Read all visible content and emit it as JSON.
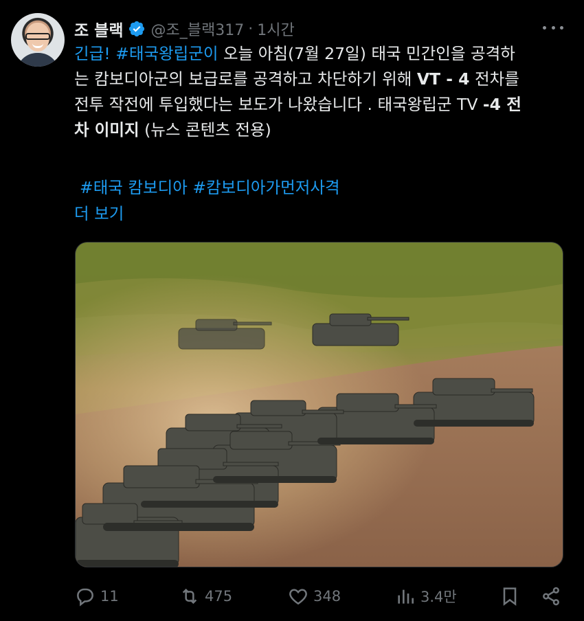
{
  "author": {
    "display_name": "조 블랙",
    "handle": "@조_블랙317",
    "separator": "·",
    "time": "1시간"
  },
  "tweet": {
    "segments": [
      {
        "text": "긴급! #태국왕립군이",
        "style": "link"
      },
      {
        "text": " 오늘 아침(7월 27일) 태국 민간인을 공격하",
        "style": "normal"
      },
      {
        "text": "는 캄보디아군의 보급로를 공격하고 차단하기 위해 ",
        "style": "normal"
      },
      {
        "text": "VT - 4",
        "style": "bold"
      },
      {
        "text": " 전차를",
        "style": "normal"
      },
      {
        "text": "전투 작전에 투입했다는 보도가 나왔습니다 . 태국왕립군 TV ",
        "style": "normal"
      },
      {
        "text": "-4 전",
        "style": "bold"
      },
      {
        "text": "차 이미지",
        "style": "bold"
      },
      {
        "text": " (뉴스 콘텐츠 전용)",
        "style": "normal"
      }
    ],
    "hashtags": "#태국 캄보디아 #캄보디아가먼저사격",
    "show_more": "더 보기"
  },
  "actions": {
    "reply_count": "11",
    "retweet_count": "475",
    "like_count": "348",
    "view_count": "3.4만"
  },
  "icons": [
    "verified-badge-icon",
    "more-options-icon",
    "reply-icon",
    "retweet-icon",
    "like-icon",
    "views-icon",
    "bookmark-icon",
    "share-icon"
  ],
  "colors": {
    "background": "#000000",
    "text": "#e7e9ea",
    "secondary": "#71767b",
    "link": "#1d9bf0"
  }
}
